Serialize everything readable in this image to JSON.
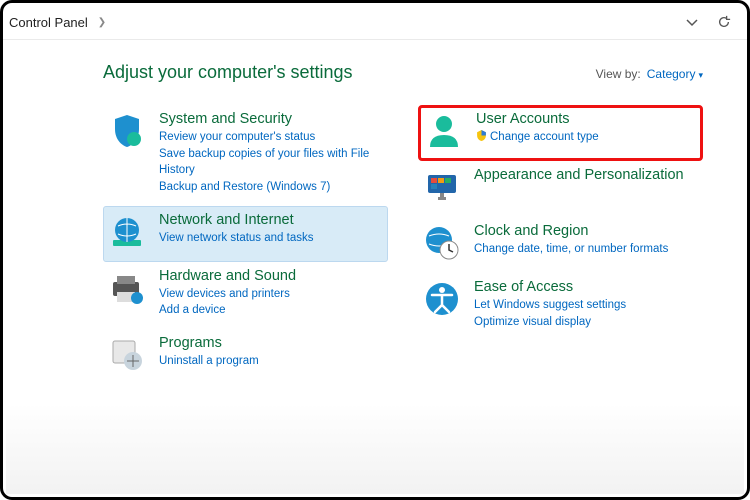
{
  "addressbar": {
    "crumb": "Control Panel",
    "dropdown_icon": "chevron-down",
    "refresh_icon": "refresh"
  },
  "page_title": "Adjust your computer's settings",
  "viewby": {
    "label": "View by:",
    "value": "Category"
  },
  "left": [
    {
      "id": "system-security",
      "title": "System and Security",
      "links": [
        "Review your computer's status",
        "Save backup copies of your files with File History",
        "Backup and Restore (Windows 7)"
      ]
    },
    {
      "id": "network-internet",
      "title": "Network and Internet",
      "links": [
        "View network status and tasks"
      ],
      "highlighted": true
    },
    {
      "id": "hardware-sound",
      "title": "Hardware and Sound",
      "links": [
        "View devices and printers",
        "Add a device"
      ]
    },
    {
      "id": "programs",
      "title": "Programs",
      "links": [
        "Uninstall a program"
      ]
    }
  ],
  "right": [
    {
      "id": "user-accounts",
      "title": "User Accounts",
      "links": [
        "Change account type"
      ],
      "shield": true,
      "redbox": true
    },
    {
      "id": "appearance",
      "title": "Appearance and Personalization",
      "links": []
    },
    {
      "id": "clock-region",
      "title": "Clock and Region",
      "links": [
        "Change date, time, or number formats"
      ]
    },
    {
      "id": "ease-of-access",
      "title": "Ease of Access",
      "links": [
        "Let Windows suggest settings",
        "Optimize visual display"
      ]
    }
  ]
}
